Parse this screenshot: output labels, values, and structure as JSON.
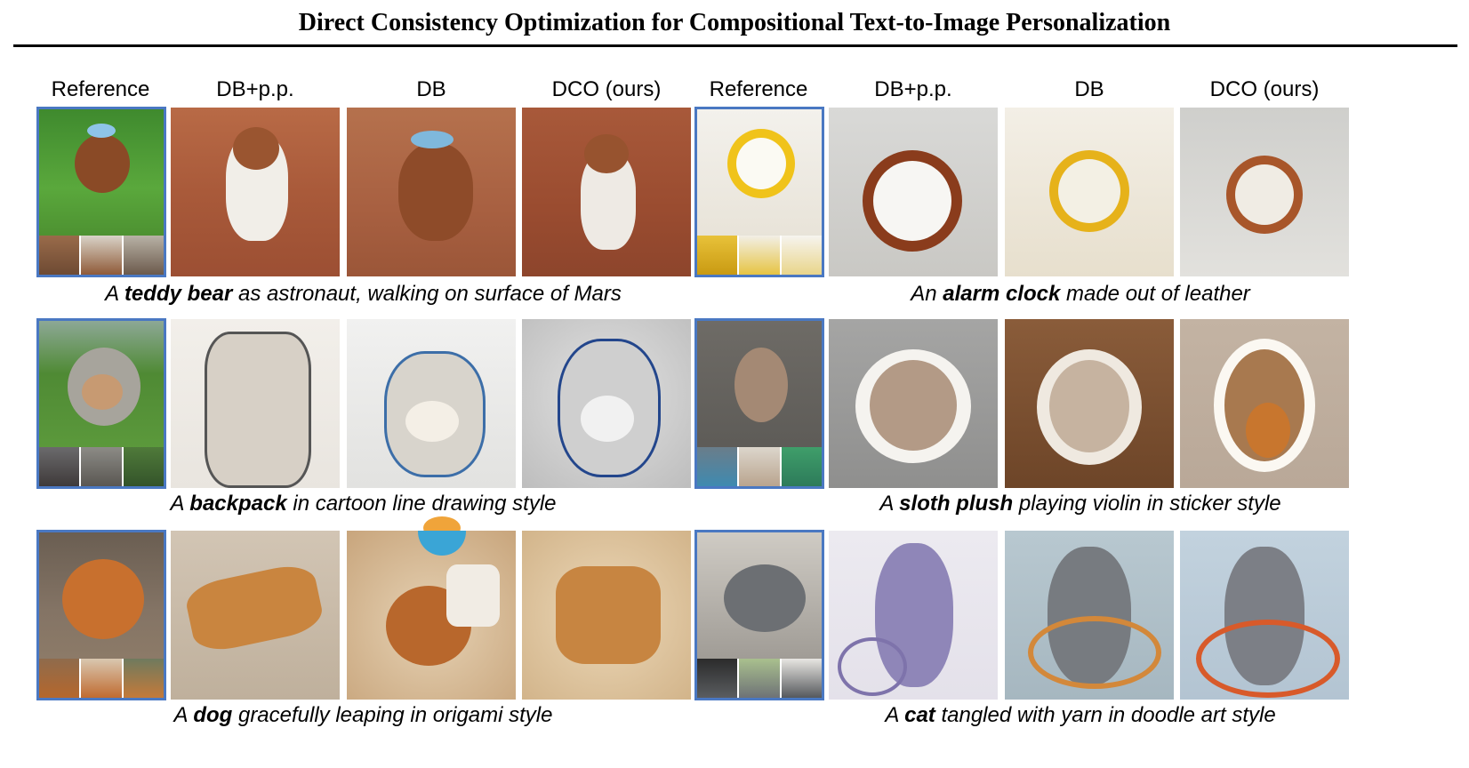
{
  "title": "Direct Consistency Optimization for Compositional Text-to-Image Personalization",
  "column_headers": [
    "Reference",
    "DB+p.p.",
    "DB",
    "DCO (ours)",
    "Reference",
    "DB+p.p.",
    "DB",
    "DCO (ours)"
  ],
  "captions": [
    {
      "prefix": "A ",
      "subject": "teddy bear",
      "suffix": " as astronaut, walking on surface of Mars"
    },
    {
      "prefix": "An ",
      "subject": "alarm clock",
      "suffix": " made out of leather"
    },
    {
      "prefix": "A ",
      "subject": "backpack",
      "suffix": " in cartoon line drawing style"
    },
    {
      "prefix": "A ",
      "subject": "sloth plush",
      "suffix": " playing violin in sticker style"
    },
    {
      "prefix": "A ",
      "subject": "dog",
      "suffix": " gracefully leaping in origami style"
    },
    {
      "prefix": "A ",
      "subject": "cat",
      "suffix": " tangled with yarn in doodle art style"
    }
  ],
  "colors": {
    "reference_border": "#4a78c2"
  }
}
